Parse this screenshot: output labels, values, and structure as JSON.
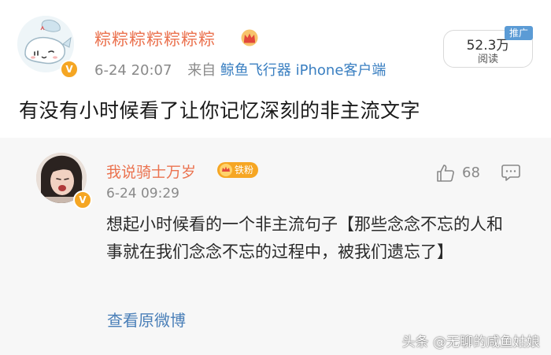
{
  "post": {
    "username": "粽粽粽粽粽粽粽",
    "time": "6-24 20:07",
    "source_prefix": "来自",
    "client": "鲸鱼飞行器 iPhone客户端",
    "read_count": "52.3万",
    "read_label": "阅读",
    "promo_label": "推广",
    "content": "有没有小时候看了让你记忆深刻的非主流文字",
    "verified_badge": "V",
    "accent_color": "#eb7350"
  },
  "comment": {
    "username": "我说骑士万岁",
    "fan_badge": "铁粉",
    "time": "6-24 09:29",
    "like_count": "68",
    "verified_badge": "V",
    "text": "想起小时候看的一个非主流句子【那些念念不忘的人和事就在我们念念不忘的过程中，被我们遗忘了】",
    "view_original": "查看原微博"
  },
  "watermark": "头条 @无聊的咸鱼姑娘",
  "icons": [
    "crown-icon",
    "like-icon",
    "reply-icon",
    "fan-badge-icon",
    "verified-icon"
  ]
}
